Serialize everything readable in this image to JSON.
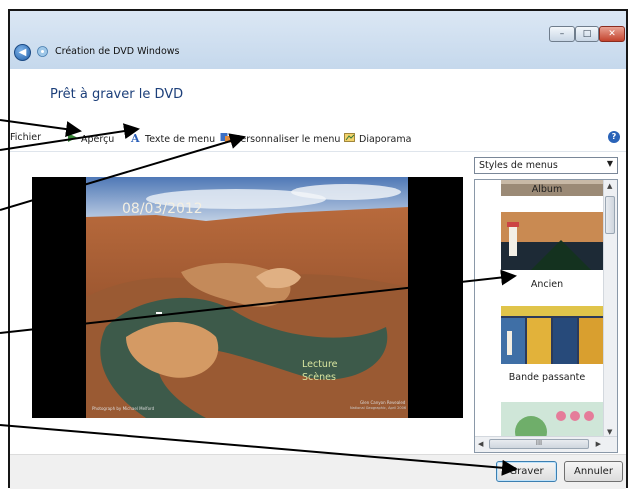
{
  "window": {
    "title": "Création de DVD Windows",
    "controls": {
      "minimize": "–",
      "maximize": "□",
      "close": "✕"
    },
    "back_icon": "back-arrow-icon"
  },
  "heading": "Prêt à graver le DVD",
  "toolbar": {
    "file": "Fichier",
    "preview": "Aperçu",
    "menu_text": "Texte de menu",
    "customize_menu": "Personnaliser le menu",
    "slideshow": "Diaporama",
    "help": "?"
  },
  "preview": {
    "date": "08/03/2012",
    "play": "Lecture",
    "scenes": "Scènes",
    "credit_left": "Photograph by Michael Melford",
    "credit_right": "Glen Canyon Revealed",
    "credit_right2": "National Geographic, April 2006"
  },
  "styles": {
    "dropdown_value": "Styles de menus",
    "items": [
      {
        "label": "Album"
      },
      {
        "label": "Ancien"
      },
      {
        "label": "Bande passante"
      }
    ],
    "scroll_grip": "III"
  },
  "buttons": {
    "burn": "Graver",
    "cancel": "Annuler"
  },
  "colors": {
    "heading": "#1c3f7a",
    "annotation": "#000000",
    "menu_link": "#d9e6a0"
  }
}
